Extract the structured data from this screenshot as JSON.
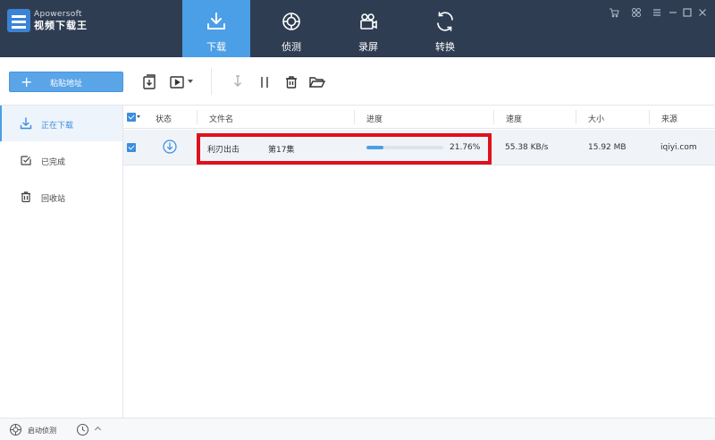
{
  "app": {
    "brand_en": "Apowersoft",
    "brand_cn": "视频下载王"
  },
  "nav": {
    "tabs": [
      {
        "label": "下载",
        "icon": "download-icon",
        "active": true
      },
      {
        "label": "侦测",
        "icon": "detect-icon",
        "active": false
      },
      {
        "label": "录屏",
        "icon": "record-icon",
        "active": false
      },
      {
        "label": "转换",
        "icon": "convert-icon",
        "active": false
      }
    ]
  },
  "window_controls": [
    "cart-icon",
    "settings-icon",
    "menu-icon",
    "minimize-icon",
    "maximize-icon",
    "close-icon"
  ],
  "toolbar": {
    "paste_label": "粘贴地址",
    "icons": [
      "import-icon",
      "video-menu-icon",
      "start-download-icon",
      "pause-icon",
      "delete-icon",
      "open-folder-icon"
    ]
  },
  "sidebar": {
    "items": [
      {
        "label": "正在下载",
        "icon": "download-icon",
        "active": true
      },
      {
        "label": "已完成",
        "icon": "completed-icon",
        "active": false
      },
      {
        "label": "回收站",
        "icon": "trash-icon",
        "active": false
      }
    ]
  },
  "table": {
    "columns": {
      "status": "状态",
      "filename": "文件名",
      "progress": "进度",
      "speed": "速度",
      "size": "大小",
      "source": "来源"
    },
    "rows": [
      {
        "title": "利刃出击",
        "episode": "第17集",
        "progress_text": "21.76%",
        "progress_value": 21.76,
        "speed": "55.38 KB/s",
        "size": "15.92 MB",
        "source": "iqiyi.com",
        "checked": true
      }
    ]
  },
  "footer": {
    "detect_label": "启动侦测"
  },
  "colors": {
    "titlebar": "#2f3d52",
    "accent": "#4b9fe6",
    "highlight": "#e0101c"
  }
}
